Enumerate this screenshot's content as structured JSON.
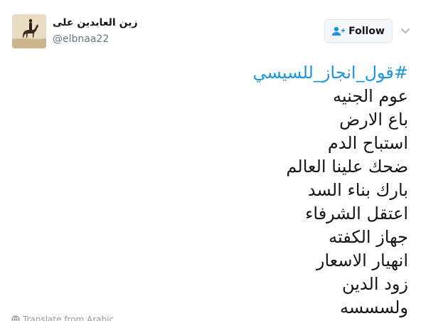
{
  "user": {
    "display_name": "زين العابدين على",
    "handle": "@elbnaa22",
    "avatar_icon": "horse-rider-avatar"
  },
  "follow_button": {
    "label": "Follow",
    "icon": "add-user-icon"
  },
  "menu_caret": {
    "icon": "chevron-down-icon"
  },
  "tweet": {
    "hashtag": "#قول_انجاز_للسيسي",
    "lines": [
      "عوم الجنيه",
      "باع الارض",
      "استباح الدم",
      "ضحك علينا العالم",
      "بارك بناء السد",
      "اعتقل الشرفاء",
      "جهاز الكفته",
      "انهيار الاسعار",
      "زود الدين",
      "ولسسسه"
    ]
  },
  "translate": {
    "label": "Translate from Arabic",
    "icon": "globe-icon"
  },
  "colors": {
    "hashtag": "#1b95e0",
    "text": "#14171a",
    "muted": "#657786"
  }
}
